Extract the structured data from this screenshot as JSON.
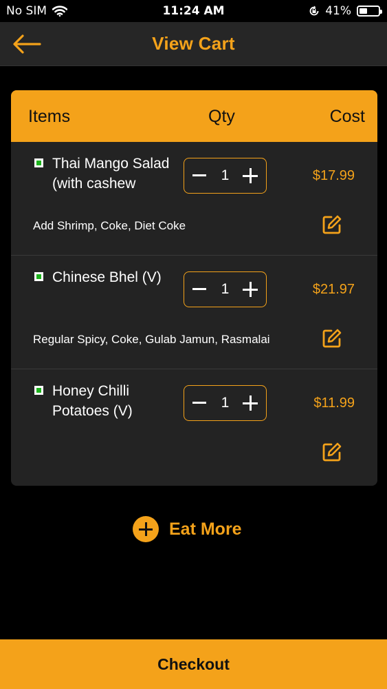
{
  "status_bar": {
    "carrier": "No SIM",
    "time": "11:24 AM",
    "battery_percent": "41%",
    "battery_level": 0.41
  },
  "header": {
    "title": "View Cart",
    "back_icon": "arrow-left-icon"
  },
  "cart": {
    "columns": {
      "items": "Items",
      "qty": "Qty",
      "cost": "Cost"
    },
    "items": [
      {
        "name": "Thai Mango Salad (with cashew",
        "qty": "1",
        "price": "$17.99",
        "addons": "Add Shrimp, Coke, Diet Coke"
      },
      {
        "name": "Chinese Bhel (V)",
        "qty": "1",
        "price": "$21.97",
        "addons": "Regular Spicy, Coke, Gulab Jamun, Rasmalai"
      },
      {
        "name": "Honey Chilli Potatoes (V)",
        "qty": "1",
        "price": "$11.99",
        "addons": ""
      }
    ]
  },
  "eat_more": {
    "label": "Eat More"
  },
  "checkout": {
    "label": "Checkout"
  },
  "colors": {
    "accent": "#F4A21A",
    "background": "#000000",
    "card": "#232323",
    "veg": "#1DB31D"
  }
}
